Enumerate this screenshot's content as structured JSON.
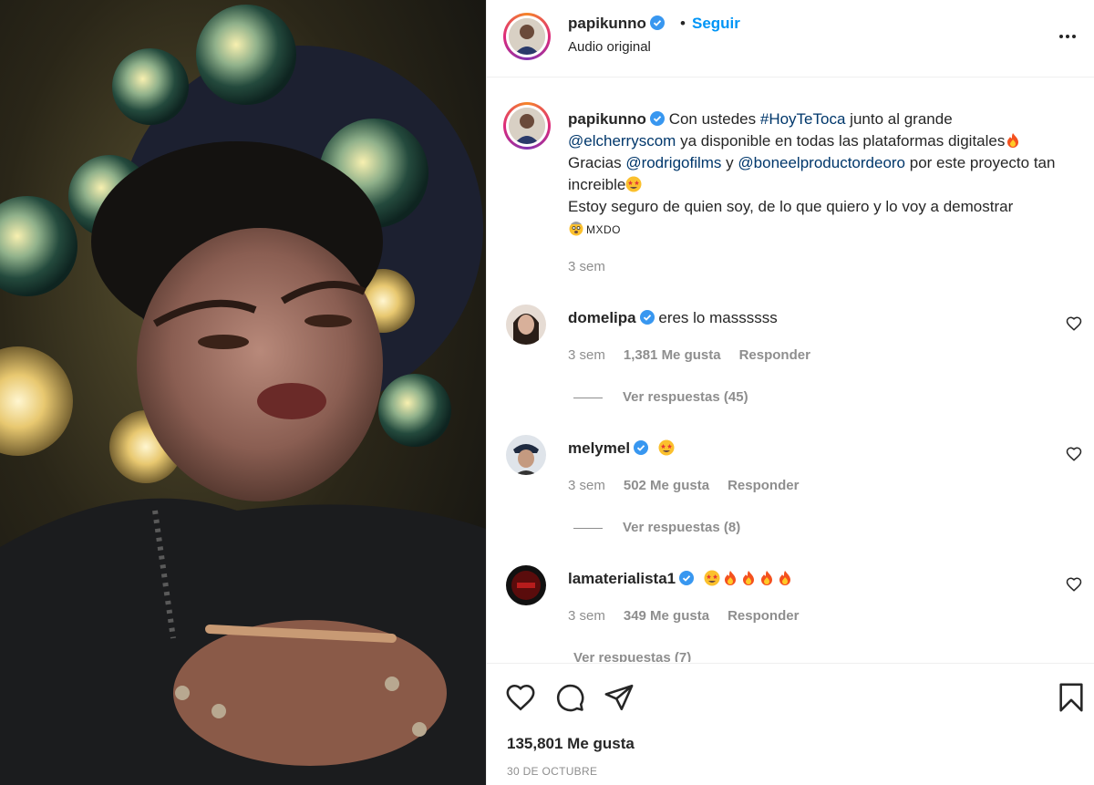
{
  "header": {
    "username": "papikunno",
    "follow_label": "Seguir",
    "subtitle": "Audio original",
    "separator": "•"
  },
  "caption": {
    "username": "papikunno",
    "text_1": "Con ustedes",
    "hashtag": "#HoyTeToca",
    "text_2": "junto al grande",
    "mention_1": "@elcherryscom",
    "text_3": "ya disponible en todas las plataformas digitales",
    "text_4": "Gracias",
    "mention_2": "@rodrigofilms",
    "text_5": "y",
    "mention_3": "@boneelproductordeoro",
    "text_6": "por este proyecto tan increible",
    "text_7": "Estoy seguro de quien soy, de lo que quiero y lo voy a demostrar",
    "text_8": "MXDO",
    "time": "3 sem"
  },
  "comments": [
    {
      "username": "domelipa",
      "text": "eres lo massssss",
      "time": "3 sem",
      "likes": "1,381 Me gusta",
      "reply": "Responder",
      "replies": "Ver respuestas (45)"
    },
    {
      "username": "melymel",
      "text": "",
      "time": "3 sem",
      "likes": "502 Me gusta",
      "reply": "Responder",
      "replies": "Ver respuestas (8)"
    },
    {
      "username": "lamaterialista1",
      "text": "",
      "time": "3 sem",
      "likes": "349 Me gusta",
      "reply": "Responder",
      "replies": "Ver respuestas (7)"
    }
  ],
  "footer": {
    "likes": "135,801 Me gusta",
    "date": "30 DE OCTUBRE"
  },
  "icons": {
    "verified": "verified-badge-icon",
    "more": "more-options-icon",
    "like": "heart-icon",
    "comment": "comment-icon",
    "share": "send-icon",
    "save": "bookmark-icon"
  },
  "colors": {
    "accent": "#0095f6",
    "link": "#00376b",
    "muted": "#8e8e8e",
    "verified": "#3897f0"
  }
}
